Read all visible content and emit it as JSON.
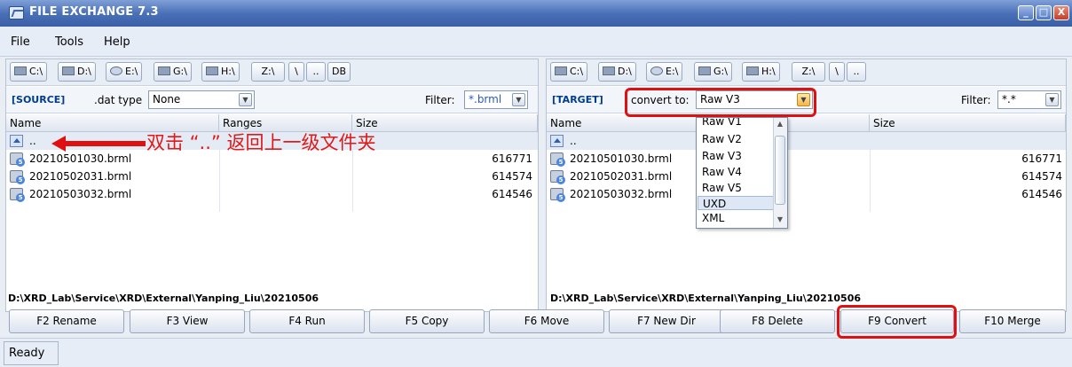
{
  "window": {
    "title": "FILE EXCHANGE 7.3",
    "min": "_",
    "max": "□",
    "close": "X"
  },
  "menu": [
    "File",
    "Tools",
    "Help"
  ],
  "left": {
    "drives": [
      "C:\\",
      "D:\\",
      "E:\\",
      "G:\\",
      "H:\\",
      "Z:\\",
      "\\",
      "..",
      "DB"
    ],
    "tag": "[SOURCE]",
    "type_label": ".dat type",
    "type_value": "None",
    "filter_label": "Filter:",
    "filter_value": "*.brml",
    "columns": [
      "Name",
      "Ranges",
      "Size"
    ],
    "up": "..",
    "files": [
      {
        "name": "20210501030.brml",
        "size": "616771"
      },
      {
        "name": "20210502031.brml",
        "size": "614574"
      },
      {
        "name": "20210503032.brml",
        "size": "614546"
      }
    ],
    "path": "D:\\XRD_Lab\\Service\\XRD\\External\\Yanping_Liu\\20210506"
  },
  "right": {
    "drives": [
      "C:\\",
      "D:\\",
      "E:\\",
      "G:\\",
      "H:\\",
      "Z:\\",
      "\\",
      ".."
    ],
    "tag": "[TARGET]",
    "convert_label": "convert to:",
    "convert_value": "Raw V3",
    "filter_label": "Filter:",
    "filter_value": "*.*",
    "columns": [
      "Name",
      "Size"
    ],
    "up": "..",
    "files": [
      {
        "name": "20210501030.brml",
        "size": "616771"
      },
      {
        "name": "20210502031.brml",
        "size": "614574"
      },
      {
        "name": "20210503032.brml",
        "size": "614546"
      }
    ],
    "path": "D:\\XRD_Lab\\Service\\XRD\\External\\Yanping_Liu\\20210506"
  },
  "dropdown_options": [
    "Raw V1",
    "Raw V2",
    "Raw V3",
    "Raw V4",
    "Raw V5",
    "UXD",
    "XML"
  ],
  "buttons": [
    "F2 Rename",
    "F3 View",
    "F4 Run",
    "F5 Copy",
    "F6 Move",
    "F7 New Dir",
    "F8 Delete",
    "F9 Convert",
    "F10 Merge"
  ],
  "status": "Ready",
  "annotation": "双击 “..” 返回上一级文件夹",
  "colors": {
    "title": "#4a70b8",
    "annotation": "#e01010",
    "tag": "#003d8f"
  }
}
